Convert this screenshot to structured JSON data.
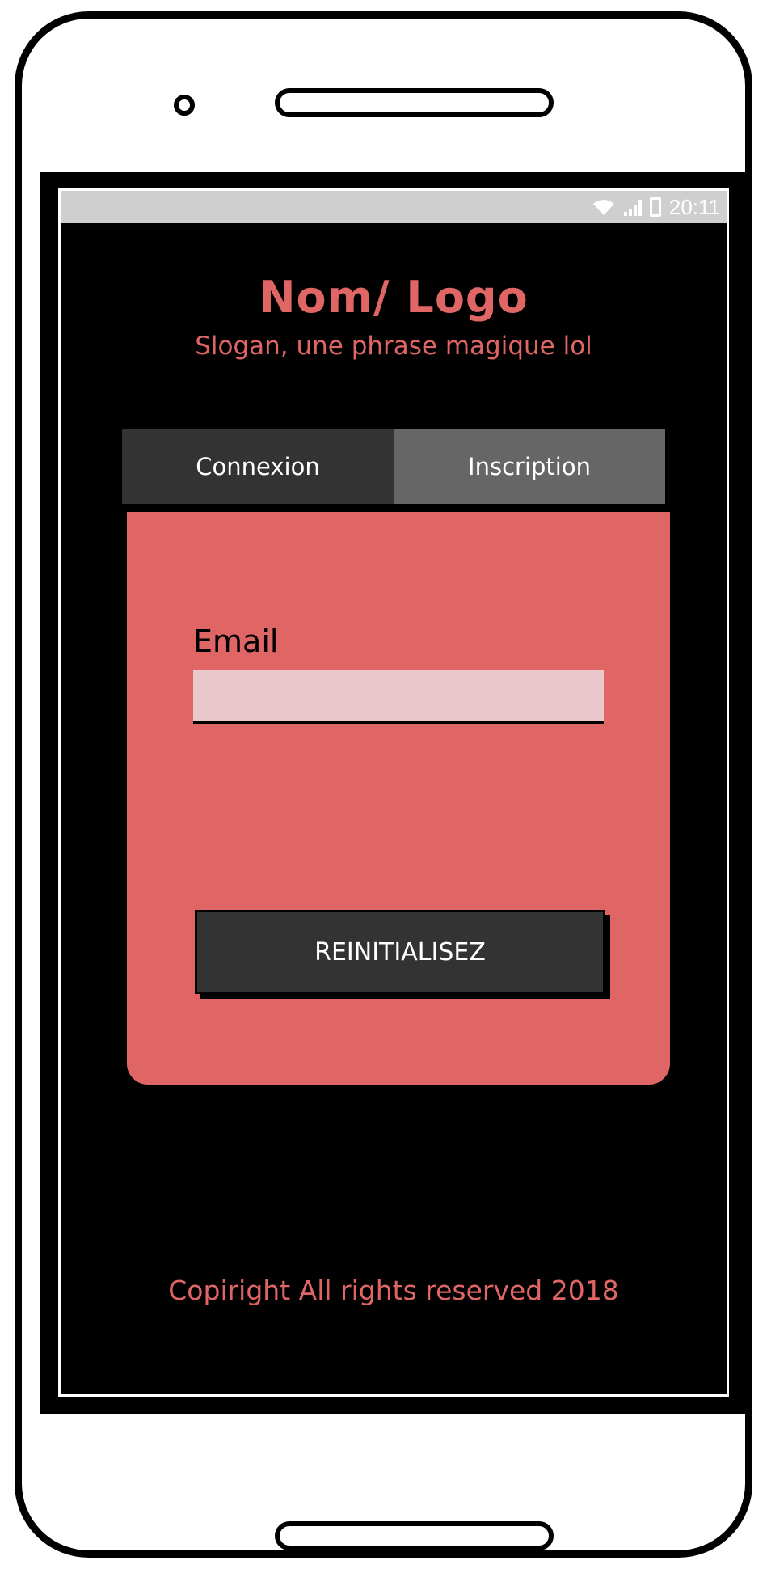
{
  "status_bar": {
    "time": "20:11",
    "icons": [
      "wifi-icon",
      "signal-icon",
      "battery-icon"
    ]
  },
  "brand": {
    "title": "Nom/ Logo",
    "slogan": "Slogan, une phrase magique lol"
  },
  "tabs": [
    {
      "label": "Connexion"
    },
    {
      "label": "Inscription"
    }
  ],
  "form": {
    "email_label": "Email",
    "email_value": "",
    "reset_button": "REINITIALISEZ"
  },
  "footer": {
    "copyright": "Copiright All rights reserved 2018"
  },
  "colors": {
    "accent": "#e06666",
    "dark": "#333333",
    "tab_inactive": "#666666",
    "input_bg": "#eac9cc",
    "status_bar": "#cfcfcf"
  }
}
